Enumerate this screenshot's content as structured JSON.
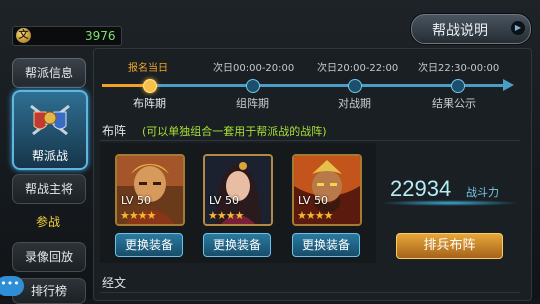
{
  "currency": {
    "amount": "3976",
    "icon": "coin-icon"
  },
  "help_button": {
    "label": "帮战说明"
  },
  "sidebar": {
    "items": [
      {
        "label": "帮派信息"
      },
      {
        "label": "帮派战"
      },
      {
        "label": "帮战主将"
      },
      {
        "label": "参战"
      },
      {
        "label": "录像回放"
      },
      {
        "label": "排行榜"
      }
    ]
  },
  "chat": {
    "label": "•••"
  },
  "timeline": {
    "stages": [
      {
        "time": "报名当日",
        "label": "布阵期",
        "current": true
      },
      {
        "time": "次日00:00-20:00",
        "label": "组阵期",
        "current": false
      },
      {
        "time": "次日20:00-22:00",
        "label": "对战期",
        "current": false
      },
      {
        "time": "次日22:30-00:00",
        "label": "结果公示",
        "current": false
      }
    ]
  },
  "lineup": {
    "title": "布阵",
    "note": "(可以单独组合一套用于帮派战的战阵)",
    "heroes": [
      {
        "level": "LV 50",
        "stars": "★★★★",
        "swap_label": "更换装备"
      },
      {
        "level": "LV 50",
        "stars": "★★★★",
        "swap_label": "更换装备"
      },
      {
        "level": "LV 50",
        "stars": "★★★★",
        "swap_label": "更换装备"
      }
    ],
    "power_value": "22934",
    "power_label": "战斗力",
    "deploy_label": "排兵布阵"
  },
  "scripture": {
    "title": "经文"
  },
  "colors": {
    "accent": "#4a9dc6",
    "current_stage": "#f0a126",
    "note": "#a8e035",
    "power": "#b6ecf8"
  }
}
